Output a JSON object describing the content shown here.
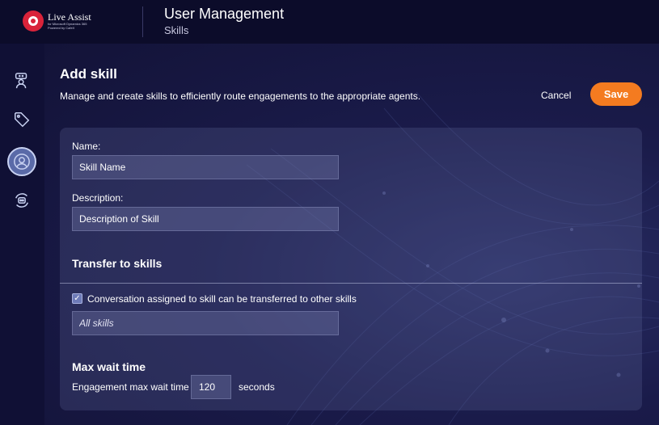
{
  "header": {
    "logo_title": "Live Assist",
    "logo_subtitle": "for Microsoft Dynamics 365",
    "logo_powered": "Powered by CafeX",
    "app_title": "User Management",
    "app_subtitle": "Skills"
  },
  "sidebar": {
    "items": [
      {
        "icon": "chat-user-icon",
        "active": false
      },
      {
        "icon": "tag-icon",
        "active": false
      },
      {
        "icon": "user-circle-icon",
        "active": true
      },
      {
        "icon": "bot-sync-icon",
        "active": false
      }
    ]
  },
  "page": {
    "title": "Add skill",
    "description": "Manage and create skills to efficiently route engagements to the appropriate agents.",
    "cancel_label": "Cancel",
    "save_label": "Save"
  },
  "form": {
    "name_label": "Name:",
    "name_placeholder": "Skill Name",
    "description_label": "Description:",
    "description_placeholder": "Description of Skill",
    "transfer_heading": "Transfer to skills",
    "transfer_checkbox_label": "Conversation assigned to skill can be transferred to other skills",
    "transfer_checked": true,
    "skills_placeholder": "All skills",
    "wait_heading": "Max wait time",
    "wait_label": "Engagement max wait time",
    "wait_value": "120",
    "wait_unit": "seconds"
  },
  "colors": {
    "accent": "#f47b20",
    "background": "#12123a",
    "topbar": "#0c0c2a",
    "logo_red": "#d9233a"
  }
}
